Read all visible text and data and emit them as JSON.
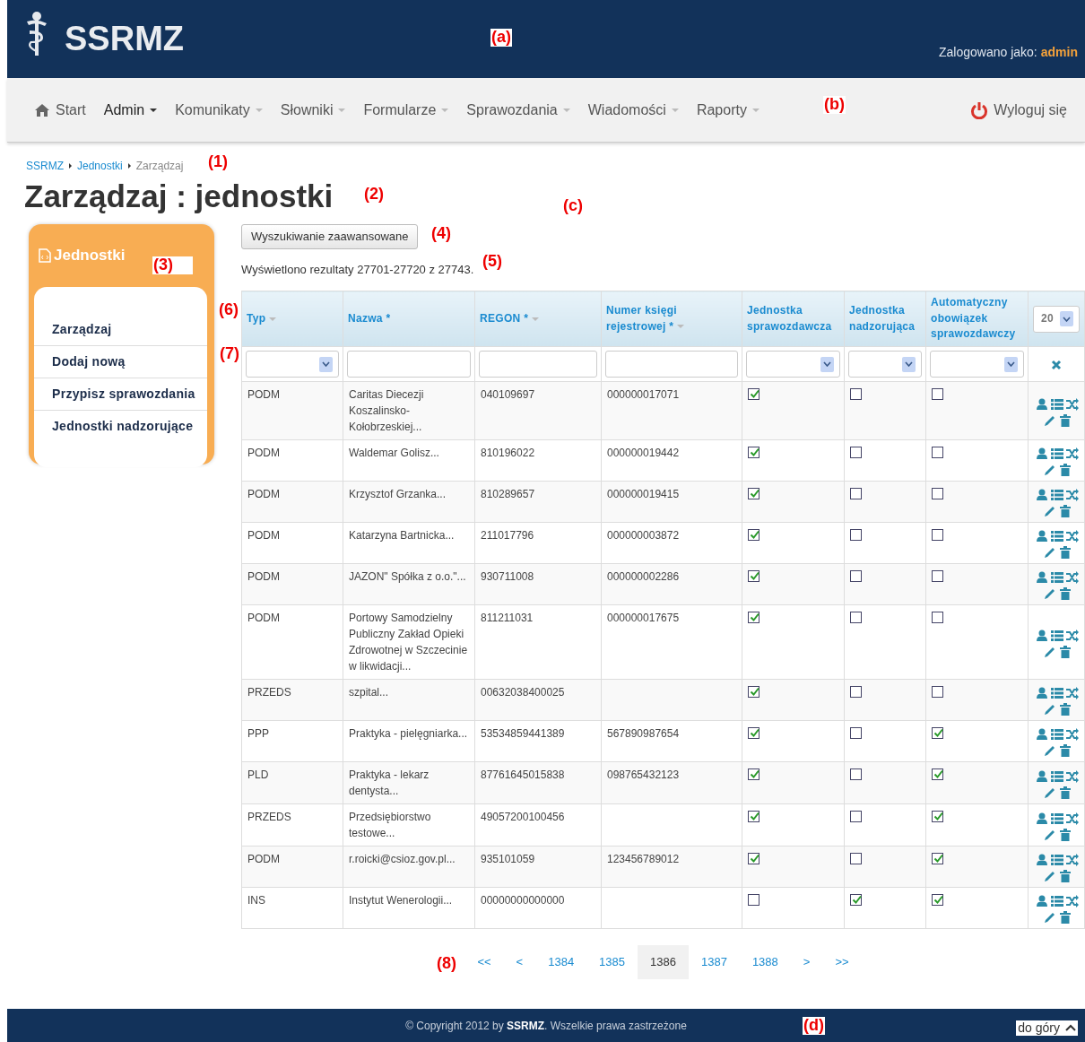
{
  "header": {
    "brand": "SSRMZ",
    "logged_in_label": "Zalogowano jako:",
    "user": "admin"
  },
  "navbar": {
    "items": [
      {
        "label": "Start",
        "kind": "home",
        "active": false
      },
      {
        "label": "Admin",
        "kind": "menu",
        "active": true
      },
      {
        "label": "Komunikaty",
        "kind": "menu",
        "active": false
      },
      {
        "label": "Słowniki",
        "kind": "menu",
        "active": false
      },
      {
        "label": "Formularze",
        "kind": "menu",
        "active": false
      },
      {
        "label": "Sprawozdania",
        "kind": "menu",
        "active": false
      },
      {
        "label": "Wiadomości",
        "kind": "menu",
        "active": false
      },
      {
        "label": "Raporty",
        "kind": "menu",
        "active": false
      }
    ],
    "logout": "Wyloguj się"
  },
  "breadcrumb": [
    {
      "label": "SSRMZ",
      "link": true
    },
    {
      "label": "Jednostki",
      "link": true
    },
    {
      "label": "Zarządzaj",
      "link": false
    }
  ],
  "page_title": "Zarządzaj : jednostki",
  "sidebar": {
    "title": "Jednostki",
    "items": [
      "Zarządzaj",
      "Dodaj nową",
      "Przypisz sprawozdania",
      "Jednostki nadzorujące"
    ]
  },
  "advanced_search_button": "Wyszukiwanie zaawansowane",
  "summary": "Wyświetlono rezultaty 27701-27720 z 27743.",
  "table": {
    "columns": [
      {
        "label": "Typ",
        "sortable": true,
        "kind": "select"
      },
      {
        "label": "Nazwa *",
        "sortable": false,
        "kind": "text"
      },
      {
        "label": "REGON *",
        "sortable": true,
        "kind": "text"
      },
      {
        "label": "Numer księgi rejestrowej *",
        "sortable": true,
        "kind": "text"
      },
      {
        "label": "Jednostka sprawozdawcza",
        "sortable": false,
        "kind": "select"
      },
      {
        "label": "Jednostka nadzorująca",
        "sortable": false,
        "kind": "select"
      },
      {
        "label": "Automatyczny obowiązek sprawozdawczy",
        "sortable": false,
        "kind": "select"
      }
    ],
    "page_size": "20",
    "rows": [
      {
        "typ": "PODM",
        "nazwa": "Caritas Diecezji Koszalinsko-Kołobrzeskiej...",
        "regon": "040109697",
        "numer": "000000017071",
        "sprawozdawcza": true,
        "nadzorujaca": false,
        "automatyczny": false
      },
      {
        "typ": "PODM",
        "nazwa": "Waldemar Golisz...",
        "regon": "810196022",
        "numer": "000000019442",
        "sprawozdawcza": true,
        "nadzorujaca": false,
        "automatyczny": false
      },
      {
        "typ": "PODM",
        "nazwa": "Krzysztof Grzanka...",
        "regon": "810289657",
        "numer": "000000019415",
        "sprawozdawcza": true,
        "nadzorujaca": false,
        "automatyczny": false
      },
      {
        "typ": "PODM",
        "nazwa": "Katarzyna Bartnicka...",
        "regon": "211017796",
        "numer": "000000003872",
        "sprawozdawcza": true,
        "nadzorujaca": false,
        "automatyczny": false
      },
      {
        "typ": "PODM",
        "nazwa": "JAZON\" Spółka z o.o.\"...",
        "regon": "930711008",
        "numer": "000000002286",
        "sprawozdawcza": true,
        "nadzorujaca": false,
        "automatyczny": false
      },
      {
        "typ": "PODM",
        "nazwa": "Portowy Samodzielny Publiczny Zakład Opieki Zdrowotnej w Szczecinie w likwidacji...",
        "regon": "811211031",
        "numer": "000000017675",
        "sprawozdawcza": true,
        "nadzorujaca": false,
        "automatyczny": false
      },
      {
        "typ": "PRZEDS",
        "nazwa": "szpital...",
        "regon": "00632038400025",
        "numer": "",
        "sprawozdawcza": true,
        "nadzorujaca": false,
        "automatyczny": false
      },
      {
        "typ": "PPP",
        "nazwa": "Praktyka - pielęgniarka...",
        "regon": "53534859441389",
        "numer": "567890987654",
        "sprawozdawcza": true,
        "nadzorujaca": false,
        "automatyczny": true
      },
      {
        "typ": "PLD",
        "nazwa": "Praktyka - lekarz dentysta...",
        "regon": "87761645015838",
        "numer": "098765432123",
        "sprawozdawcza": true,
        "nadzorujaca": false,
        "automatyczny": true
      },
      {
        "typ": "PRZEDS",
        "nazwa": "Przedsiębiorstwo testowe...",
        "regon": "49057200100456",
        "numer": "",
        "sprawozdawcza": true,
        "nadzorujaca": false,
        "automatyczny": true
      },
      {
        "typ": "PODM",
        "nazwa": "r.roicki@csioz.gov.pl...",
        "regon": "935101059",
        "numer": "123456789012",
        "sprawozdawcza": true,
        "nadzorujaca": false,
        "automatyczny": true
      },
      {
        "typ": "INS",
        "nazwa": "Instytut Wenerologii...",
        "regon": "00000000000000",
        "numer": "",
        "sprawozdawcza": false,
        "nadzorujaca": true,
        "automatyczny": true
      }
    ]
  },
  "pagination": [
    {
      "label": "<<",
      "selected": false
    },
    {
      "label": "<",
      "selected": false
    },
    {
      "label": "1384",
      "selected": false
    },
    {
      "label": "1385",
      "selected": false
    },
    {
      "label": "1386",
      "selected": true
    },
    {
      "label": "1387",
      "selected": false
    },
    {
      "label": "1388",
      "selected": false
    },
    {
      "label": ">",
      "selected": false
    },
    {
      "label": ">>",
      "selected": false
    }
  ],
  "footer": {
    "copyright": "© Copyright 2012 by **SSRMZ**. Wszelkie prawa zastrzeżone",
    "back_to_top": "do góry"
  },
  "annotations": [
    "(a)",
    "(b)",
    "(1)",
    "(2)",
    "(c)",
    "(3)",
    "(4)",
    "(5)",
    "(6)",
    "(7)",
    "(8)",
    "(d)"
  ]
}
